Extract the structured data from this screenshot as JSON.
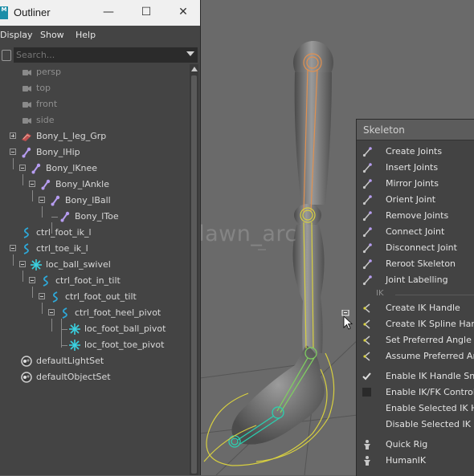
{
  "window": {
    "title": "Outliner",
    "app_icon": "M",
    "controls": {
      "minimize": "—",
      "maximize": "☐",
      "close": "✕"
    }
  },
  "menubar": [
    "Display",
    "Show",
    "Help"
  ],
  "search": {
    "placeholder": "Search..."
  },
  "outliner_items": [
    {
      "label": "persp",
      "icon": "camera-icon"
    },
    {
      "label": "top",
      "icon": "camera-icon"
    },
    {
      "label": "front",
      "icon": "camera-icon"
    },
    {
      "label": "side",
      "icon": "camera-icon"
    },
    {
      "label": "Bony_L_leg_Grp",
      "icon": "group-icon"
    },
    {
      "label": "Bony_lHip",
      "icon": "joint-icon"
    },
    {
      "label": "Bony_lKnee",
      "icon": "joint-icon"
    },
    {
      "label": "Bony_lAnkle",
      "icon": "joint-icon"
    },
    {
      "label": "Bony_lBall",
      "icon": "joint-icon"
    },
    {
      "label": "Bony_lToe",
      "icon": "joint-icon"
    },
    {
      "label": "ctrl_foot_ik_l",
      "icon": "curve-icon"
    },
    {
      "label": "ctrl_toe_ik_l",
      "icon": "curve-icon"
    },
    {
      "label": "loc_ball_swivel",
      "icon": "locator-icon"
    },
    {
      "label": "ctrl_foot_in_tilt",
      "icon": "curve-icon"
    },
    {
      "label": "ctrl_foot_out_tilt",
      "icon": "curve-icon"
    },
    {
      "label": "ctrl_foot_heel_pivot",
      "icon": "curve-icon"
    },
    {
      "label": "loc_foot_ball_pivot",
      "icon": "locator-icon"
    },
    {
      "label": "loc_foot_toe_pivot",
      "icon": "locator-icon"
    },
    {
      "label": "defaultLightSet",
      "icon": "set-icon"
    },
    {
      "label": "defaultObjectSet",
      "icon": "set-icon"
    }
  ],
  "viewport": {
    "watermark": "@dawn_arc"
  },
  "skeleton_menu": {
    "title": "Skeleton",
    "items": [
      "Create Joints",
      "Insert Joints",
      "Mirror Joints",
      "Orient Joint",
      "Remove Joints",
      "Connect Joint",
      "Disconnect Joint",
      "Reroot Skeleton",
      "Joint Labelling"
    ],
    "ik_section": "IK",
    "ik_items": [
      "Create IK Handle",
      "Create IK Spline Hand",
      "Set Preferred Angle",
      "Assume Preferred Ang"
    ],
    "toggle_items": [
      "Enable IK Handle Snap",
      "Enable IK/FK Control",
      "Enable Selected IK Ha",
      "Disable Selected IK Ha"
    ],
    "rig_items": [
      "Quick Rig",
      "HumanIK"
    ]
  },
  "colors": {
    "joint": "#b69cf0",
    "curve": "#2ea8d8",
    "locator": "#3ad0e0",
    "bone_orange": "#e09050",
    "bone_yellow": "#d8d040",
    "ctrl_green": "#7fd060",
    "ctrl_cyan": "#2ad0b0"
  }
}
